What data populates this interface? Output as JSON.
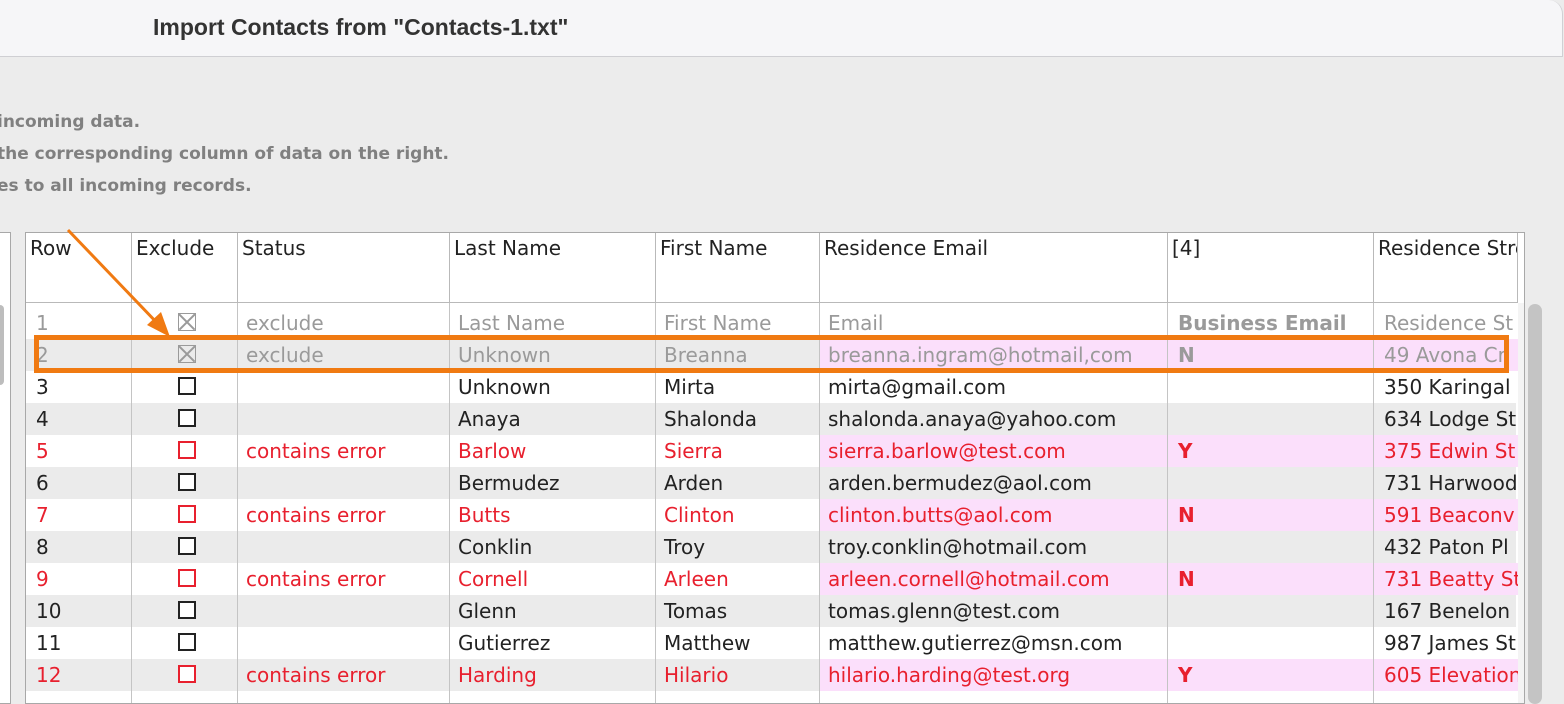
{
  "window": {
    "title": "Import Contacts from \"Contacts-1.txt\""
  },
  "instructions": [
    "incoming data.",
    "the corresponding column of data on the right.",
    "es to all incoming records."
  ],
  "columns": [
    "Row",
    "Exclude",
    "Status",
    "Last Name",
    "First Name",
    "Residence Email",
    "[4]",
    "Residence Stre"
  ],
  "rows": [
    {
      "row": "1",
      "excluded": true,
      "status": "exclude",
      "last": "Last Name",
      "first": "First Name",
      "email": "Email",
      "col4": "Business Email",
      "street": "Residence St",
      "style": "muted"
    },
    {
      "row": "2",
      "excluded": true,
      "status": "exclude",
      "last": "Unknown",
      "first": "Breanna",
      "email": "breanna.ingram@hotmail,com",
      "col4": "N",
      "street": "49 Avona Cr",
      "style": "muted"
    },
    {
      "row": "3",
      "excluded": false,
      "status": "",
      "last": "Unknown",
      "first": "Mirta",
      "email": "mirta@gmail.com",
      "col4": "",
      "street": "350 Karingal",
      "style": "normal"
    },
    {
      "row": "4",
      "excluded": false,
      "status": "",
      "last": "Anaya",
      "first": "Shalonda",
      "email": "shalonda.anaya@yahoo.com",
      "col4": "",
      "street": "634 Lodge St",
      "style": "normal"
    },
    {
      "row": "5",
      "excluded": false,
      "status": "contains error",
      "last": "Barlow",
      "first": "Sierra",
      "email": "sierra.barlow@test.com",
      "col4": "Y",
      "street": "375 Edwin St",
      "style": "error"
    },
    {
      "row": "6",
      "excluded": false,
      "status": "",
      "last": "Bermudez",
      "first": "Arden",
      "email": "arden.bermudez@aol.com",
      "col4": "",
      "street": "731 Harwood",
      "style": "normal"
    },
    {
      "row": "7",
      "excluded": false,
      "status": "contains error",
      "last": "Butts",
      "first": "Clinton",
      "email": "clinton.butts@aol.com",
      "col4": "N",
      "street": "591 Beaconv",
      "style": "error"
    },
    {
      "row": "8",
      "excluded": false,
      "status": "",
      "last": "Conklin",
      "first": "Troy",
      "email": "troy.conklin@hotmail.com",
      "col4": "",
      "street": "432 Paton Pl",
      "style": "normal"
    },
    {
      "row": "9",
      "excluded": false,
      "status": "contains error",
      "last": "Cornell",
      "first": "Arleen",
      "email": "arleen.cornell@hotmail.com",
      "col4": "N",
      "street": "731 Beatty St",
      "style": "error"
    },
    {
      "row": "10",
      "excluded": false,
      "status": "",
      "last": "Glenn",
      "first": "Tomas",
      "email": "tomas.glenn@test.com",
      "col4": "",
      "street": "167 Benelon",
      "style": "normal"
    },
    {
      "row": "11",
      "excluded": false,
      "status": "",
      "last": "Gutierrez",
      "first": "Matthew",
      "email": "matthew.gutierrez@msn.com",
      "col4": "",
      "street": "987 James St",
      "style": "normal"
    },
    {
      "row": "12",
      "excluded": false,
      "status": "contains error",
      "last": "Harding",
      "first": "Hilario",
      "email": "hilario.harding@test.org",
      "col4": "Y",
      "street": "605 Elevation",
      "style": "error"
    }
  ],
  "colors": {
    "error": "#e8202e",
    "muted": "#9a9a9a",
    "normal": "#222222",
    "pink": "#fbdffb",
    "highlight": "#f07a12"
  }
}
